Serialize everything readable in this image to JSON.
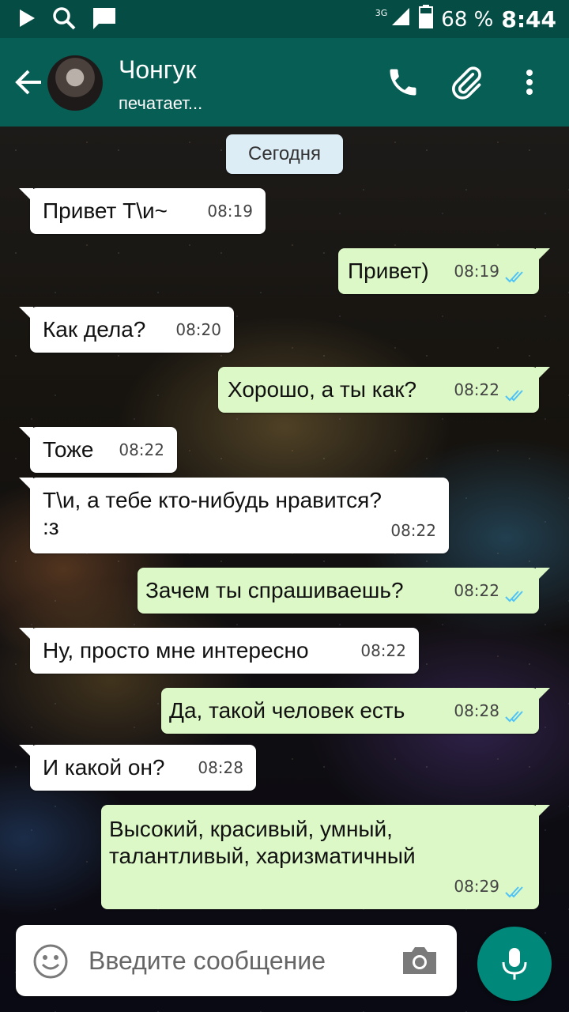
{
  "status_bar": {
    "network": "3G",
    "battery": "68 %",
    "time": "8:44"
  },
  "header": {
    "contact_name": "Чонгук",
    "contact_status": "печатает..."
  },
  "chat": {
    "date_divider": "Сегодня",
    "messages": [
      {
        "direction": "in",
        "text": "Привет Т\\и~",
        "time": "08:19"
      },
      {
        "direction": "out",
        "text": "Привет)",
        "time": "08:19",
        "status": "read"
      },
      {
        "direction": "in",
        "text": "Как дела?",
        "time": "08:20"
      },
      {
        "direction": "out",
        "text": "Хорошо, а ты как?",
        "time": "08:22",
        "status": "read"
      },
      {
        "direction": "in",
        "text": "Тоже",
        "time": "08:22"
      },
      {
        "direction": "in",
        "text": "Т\\и, а тебе кто-нибудь нравится? :з",
        "time": "08:22"
      },
      {
        "direction": "out",
        "text": "Зачем ты спрашиваешь?",
        "time": "08:22",
        "status": "read"
      },
      {
        "direction": "in",
        "text": "Ну, просто мне интересно",
        "time": "08:22"
      },
      {
        "direction": "out",
        "text": "Да, такой человек есть",
        "time": "08:28",
        "status": "read"
      },
      {
        "direction": "in",
        "text": "И какой он?",
        "time": "08:28"
      },
      {
        "direction": "out",
        "text": "Высокий, красивый, умный, талантливый, харизматичный",
        "time": "08:29",
        "status": "read"
      }
    ]
  },
  "composer": {
    "placeholder": "Введите сообщение"
  },
  "colors": {
    "header": "#075e54",
    "status_bar": "#054d44",
    "outgoing_bubble": "#dcf8c6",
    "incoming_bubble": "#ffffff",
    "read_ticks": "#4fc3f7",
    "mic_button": "#00897b"
  },
  "icons": [
    "play-icon",
    "search-icon",
    "chat-icon",
    "signal-icon",
    "battery-icon",
    "back-arrow-icon",
    "phone-icon",
    "paperclip-icon",
    "more-vert-icon",
    "emoji-icon",
    "camera-icon",
    "mic-icon",
    "double-check-icon"
  ]
}
